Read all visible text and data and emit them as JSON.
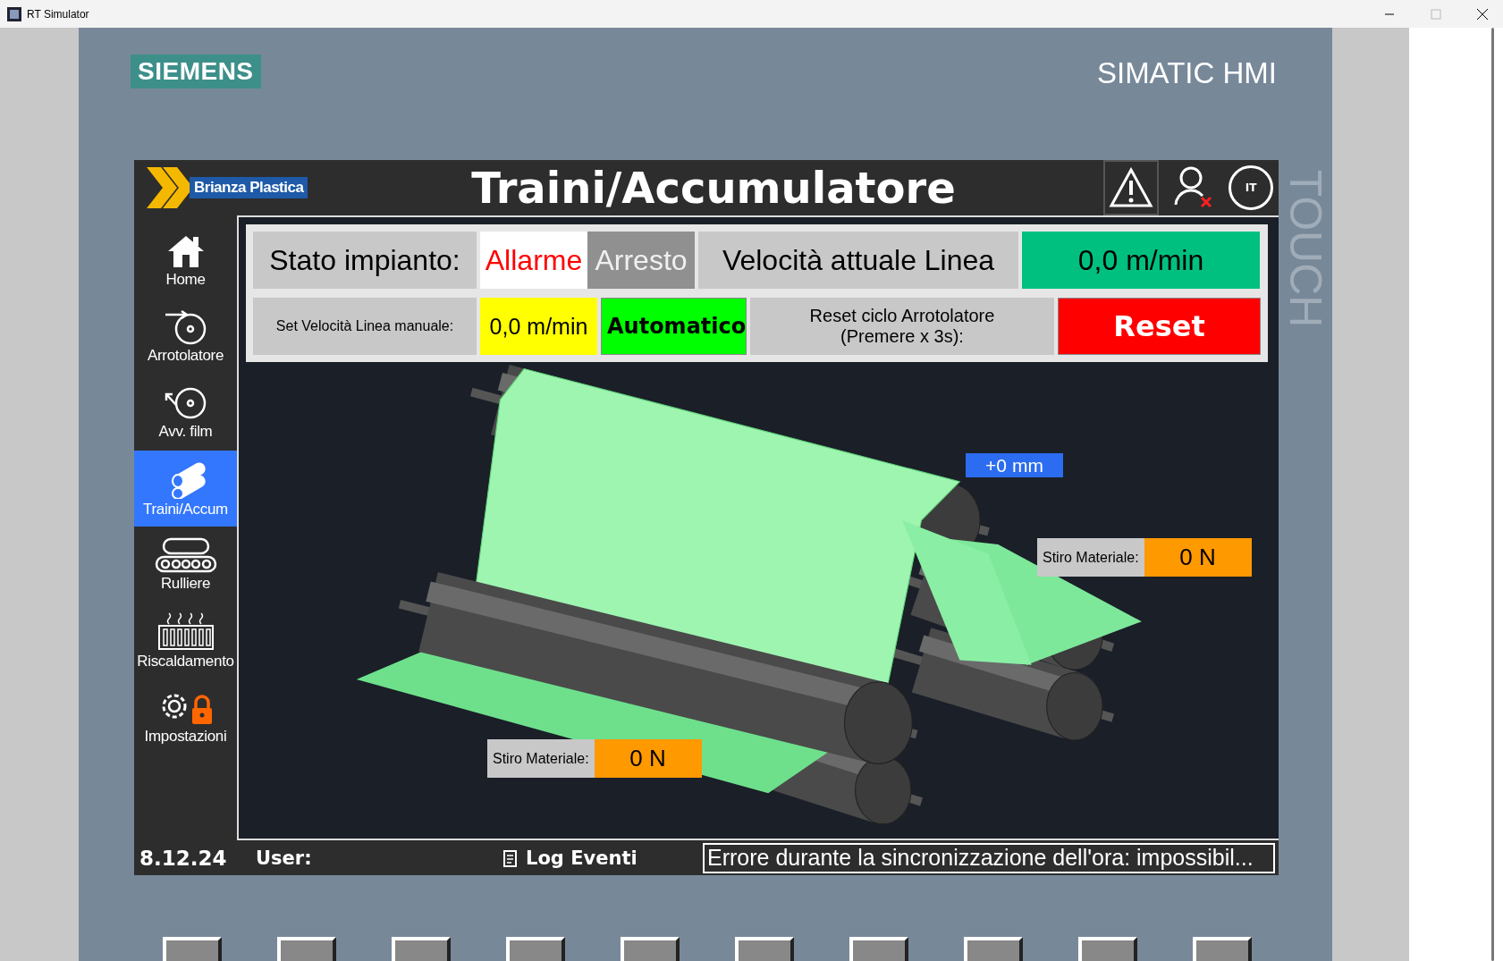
{
  "window": {
    "title": "RT Simulator"
  },
  "device": {
    "brand": "SIEMENS",
    "model": "SIMATIC HMI",
    "touch_label": "TOUCH"
  },
  "header": {
    "company": "Brianza Plastica",
    "title": "Traini/Accumulatore",
    "language": "IT"
  },
  "sidebar": {
    "items": [
      {
        "label": "Home",
        "selected": false
      },
      {
        "label": "Arrotolatore",
        "selected": false
      },
      {
        "label": "Avv. film",
        "selected": false
      },
      {
        "label": "Traini/Accum",
        "selected": true
      },
      {
        "label": "Rulliere",
        "selected": false
      },
      {
        "label": "Riscaldamento",
        "selected": false
      },
      {
        "label": "Impostazioni",
        "selected": false
      }
    ]
  },
  "status_panel": {
    "plant_state": {
      "label": "Stato impianto:",
      "states": [
        {
          "label": "Allarme",
          "kind": "alarm"
        },
        {
          "label": "Arresto",
          "kind": "stop"
        }
      ]
    },
    "line_speed": {
      "label": "Velocità attuale Linea",
      "value": "0,0 m/min"
    },
    "manual_speed": {
      "label": "Set Velocità Linea manuale:",
      "value": "0,0 m/min"
    },
    "mode": "Automatico",
    "reset": {
      "label": "Reset ciclo Arrotolatore\n(Premere x 3s):",
      "button": "Reset"
    }
  },
  "process": {
    "position": "+0 mm",
    "tensions": [
      {
        "label": "Stiro Materiale:",
        "value": "0 N"
      },
      {
        "label": "Stiro Materiale:",
        "value": "0 N"
      }
    ]
  },
  "status_bar": {
    "date": "8.12.24",
    "user_label": "User:",
    "log_button": "Log Eventi",
    "message": "Errore durante la sincronizzazione dell'ora: impossibil..."
  }
}
